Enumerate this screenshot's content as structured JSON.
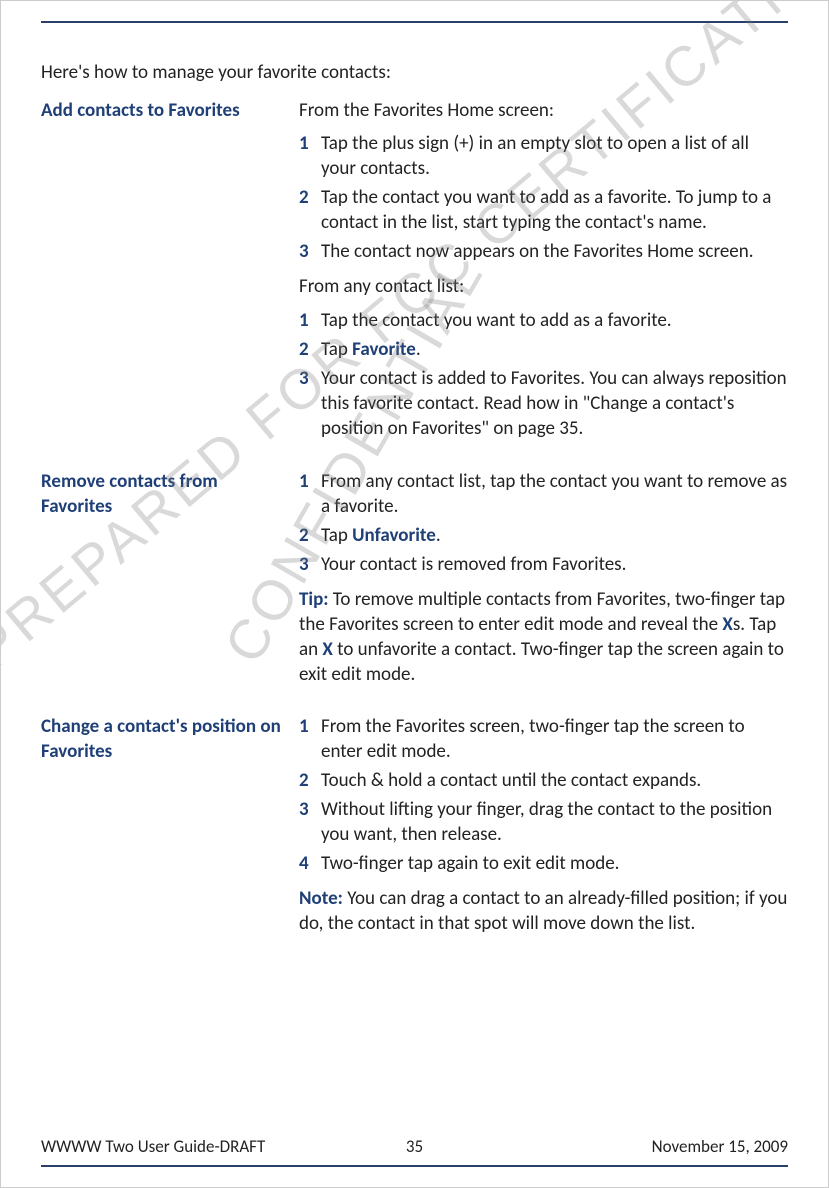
{
  "intro": "Here's how to manage your favorite contacts:",
  "sections": [
    {
      "label": "Add contacts to Favorites",
      "lead1": "From the Favorites Home screen:",
      "steps1": [
        "Tap the plus sign (+) in an empty slot to open a list of all your contacts.",
        "Tap the contact you want to add as a favorite. To jump to a contact in the list, start typing the contact's name.",
        "The contact now appears on the Favorites Home screen."
      ],
      "lead2": "From any contact list:",
      "steps2_pre": [
        "Tap the contact you want to add as a favorite."
      ],
      "steps2_kw": "Favorite",
      "steps2_kw_pre": "Tap ",
      "steps2_kw_post": ".",
      "steps2_post": [
        "Your contact is added to Favorites. You can always reposition this favorite contact. Read how in \"Change a contact's position on Favorites\" on page 35."
      ]
    },
    {
      "label": "Remove contacts from Favorites",
      "steps_pre": [
        "From any contact list, tap the contact you want to remove as a favorite."
      ],
      "kw_pre": "Tap ",
      "kw": "Unfavorite",
      "kw_post": ".",
      "steps_post": [
        "Your contact is removed from Favorites."
      ],
      "tip_label": "Tip:",
      "tip_a": " To remove multiple contacts from Favorites, two-finger tap the Favorites screen to enter edit mode and reveal the ",
      "tip_x1": "X",
      "tip_b": "s. Tap an ",
      "tip_x2": "X",
      "tip_c": " to unfavorite a contact. Two-finger tap the screen again to exit edit mode."
    },
    {
      "label": "Change a contact's position on Favorites",
      "steps": [
        "From the Favorites screen, two-finger tap the screen to enter edit mode.",
        "Touch & hold a contact until the contact expands.",
        "Without lifting your finger, drag the contact to the position you want, then release.",
        "Two-finger tap again to exit edit mode."
      ],
      "note_label": "Note:",
      "note": " You can drag a contact to an already-filled position; if you do, the contact in that spot will move down the list."
    }
  ],
  "footer": {
    "left": "WWWW Two User Guide-DRAFT",
    "center": "35",
    "right": "November 15, 2009"
  },
  "watermark1": "PREPARED FOR FCC CERTIFICATION",
  "watermark2": "CONFIDENTIAL"
}
